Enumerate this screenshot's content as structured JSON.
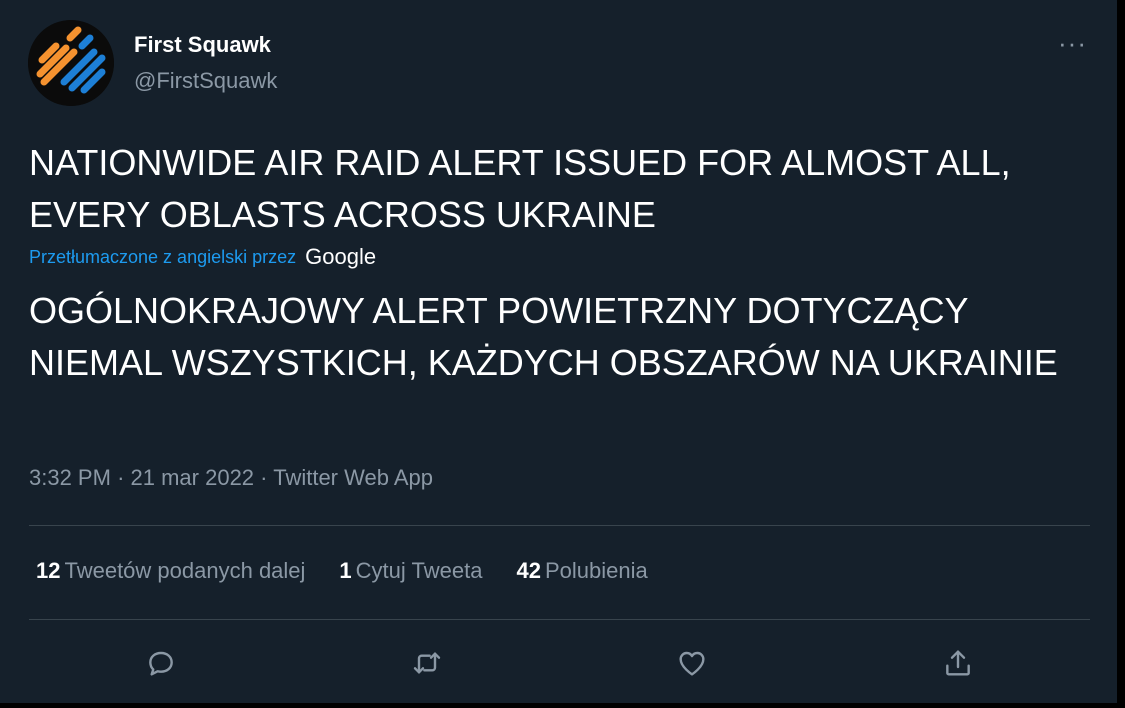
{
  "author": {
    "display_name": "First Squawk",
    "handle": "@FirstSquawk"
  },
  "tweet": {
    "original_text": "NATIONWIDE AIR RAID ALERT ISSUED FOR ALMOST ALL, EVERY OBLASTS ACROSS UKRAINE",
    "translation_label": "Przetłumaczone z angielski przez",
    "translation_provider": "Google",
    "translated_text": "OGÓLNOKRAJOWY ALERT POWIETRZNY DOTYCZĄCY NIEMAL WSZYSTKICH, KAŻDYCH OBSZARÓW NA UKRAINIE",
    "time": "3:32 PM",
    "date": "21 mar 2022",
    "source": "Twitter Web App",
    "separator": "·"
  },
  "stats": {
    "retweets_count": "12",
    "retweets_label": "Tweetów podanych dalej",
    "quotes_count": "1",
    "quotes_label": "Cytuj Tweeta",
    "likes_count": "42",
    "likes_label": "Polubienia"
  },
  "actions": {
    "more_label": "···",
    "icons": [
      "reply-icon",
      "retweet-icon",
      "like-icon",
      "share-icon"
    ]
  },
  "colors": {
    "background": "#15202b",
    "text": "#ffffff",
    "secondary_text": "#8b98a5",
    "link": "#1d9bf0",
    "divider": "#38444d",
    "logo_orange": "#f5922f",
    "logo_blue": "#1d7fd6"
  }
}
